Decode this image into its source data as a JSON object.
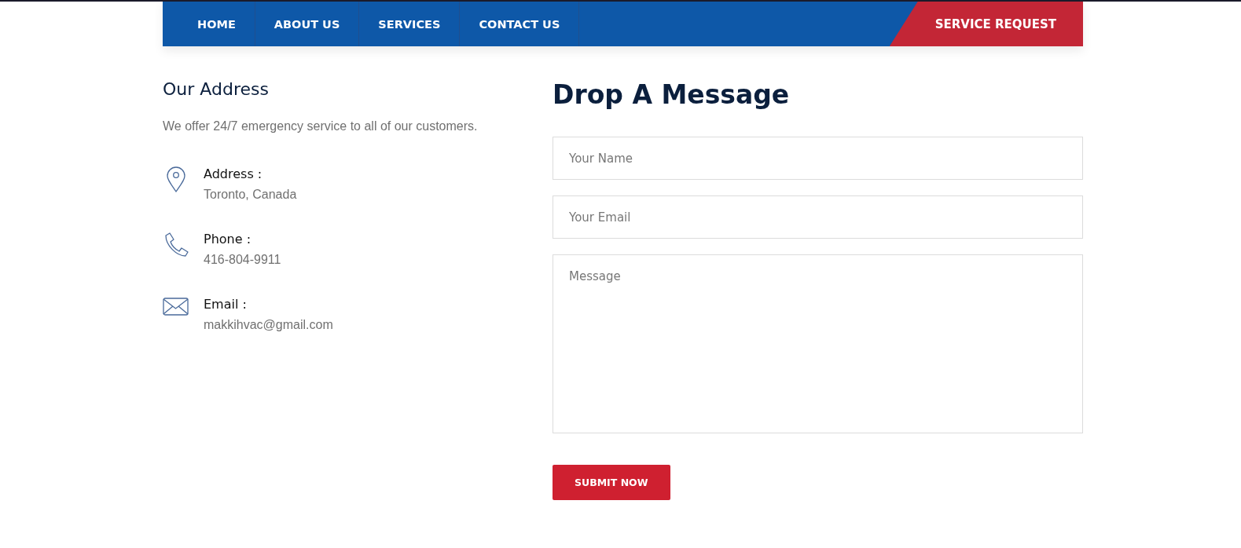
{
  "nav": {
    "items": [
      "HOME",
      "ABOUT US",
      "SERVICES",
      "CONTACT US"
    ],
    "cta": "SERVICE REQUEST"
  },
  "address": {
    "title": "Our Address",
    "intro": "We offer 24/7 emergency service to all of our customers.",
    "items": [
      {
        "kind": "location",
        "label": "Address :",
        "value": "Toronto, Canada"
      },
      {
        "kind": "phone",
        "label": "Phone :",
        "value": "416-804-9911"
      },
      {
        "kind": "email",
        "label": "Email :",
        "value": "makkihvac@gmail.com"
      }
    ]
  },
  "form": {
    "title": "Drop A Message",
    "name_placeholder": "Your Name",
    "email_placeholder": "Your Email",
    "message_placeholder": "Message",
    "submit": "SUBMIT NOW"
  }
}
